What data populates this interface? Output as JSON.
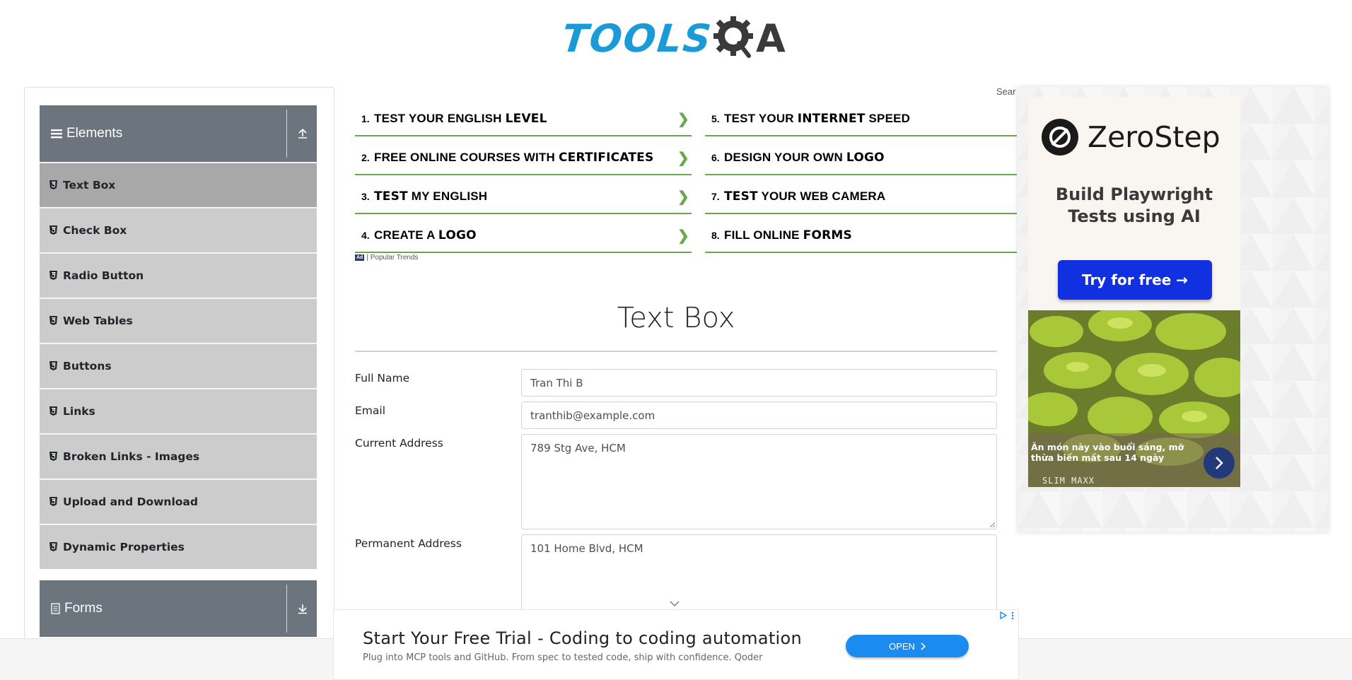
{
  "header": {
    "logo_primary": "TOOLS",
    "logo_secondary": "QA"
  },
  "sidebar": {
    "groups": [
      {
        "label": "Elements",
        "expanded": true
      },
      {
        "label": "Forms",
        "expanded": false
      }
    ],
    "items": [
      {
        "label": "Text Box",
        "active": true
      },
      {
        "label": "Check Box"
      },
      {
        "label": "Radio Button"
      },
      {
        "label": "Web Tables"
      },
      {
        "label": "Buttons"
      },
      {
        "label": "Links"
      },
      {
        "label": "Broken Links - Images"
      },
      {
        "label": "Upload and Download"
      },
      {
        "label": "Dynamic Properties"
      }
    ]
  },
  "ad_links": {
    "search_cut": "Sear",
    "popular": "| Popular Trends",
    "ad_badge": "Ad",
    "rows": [
      {
        "num": "1.",
        "pre": "TEST YOUR ENGLISH ",
        "bold": "LEVEL",
        "post": ""
      },
      {
        "num": "2.",
        "pre": "FREE ONLINE COURSES WITH ",
        "bold": "CERTIFICATES",
        "post": ""
      },
      {
        "num": "3.",
        "pre": "",
        "bold": "TEST",
        "post": " MY ENGLISH"
      },
      {
        "num": "4.",
        "pre": "CREATE A ",
        "bold": "LOGO",
        "post": ""
      },
      {
        "num": "5.",
        "pre": "TEST YOUR ",
        "bold": "INTERNET",
        "post": " SPEED"
      },
      {
        "num": "6.",
        "pre": "DESIGN YOUR OWN ",
        "bold": "LOGO",
        "post": ""
      },
      {
        "num": "7.",
        "pre": "",
        "bold": "TEST",
        "post": " YOUR WEB CAMERA"
      },
      {
        "num": "8.",
        "pre": "FILL ONLINE ",
        "bold": "FORMS",
        "post": ""
      }
    ],
    "chevron": "❯",
    "accent": "#6aa84f"
  },
  "main": {
    "title": "Text Box",
    "form": {
      "full_name_label": "Full Name",
      "full_name_value": "Tran Thi B",
      "email_label": "Email",
      "email_value": "tranthib@example.com",
      "current_address_label": "Current Address",
      "current_address_value": "789 Stg Ave, HCM",
      "permanent_address_label": "Permanent Address",
      "permanent_address_value": "101 Home Blvd, HCM"
    }
  },
  "right_ad": {
    "brand": "ZeroStep",
    "tagline_1": "Build Playwright",
    "tagline_2": "Tests using AI",
    "cta": "Try for free →",
    "cta_color": "#1130e0",
    "food_text": "Ăn món này vào buổi sáng, mỡ thừa biến mất sau 14 ngày",
    "food_brand": "SLIM MAXX"
  },
  "bottom_ad": {
    "title": "Start Your Free Trial - Coding to coding automation",
    "subtitle": "Plug into MCP tools and GitHub. From spec to tested code, ship with confidence. Qoder",
    "cta": "OPEN",
    "cta_color": "#1a8cf0"
  }
}
